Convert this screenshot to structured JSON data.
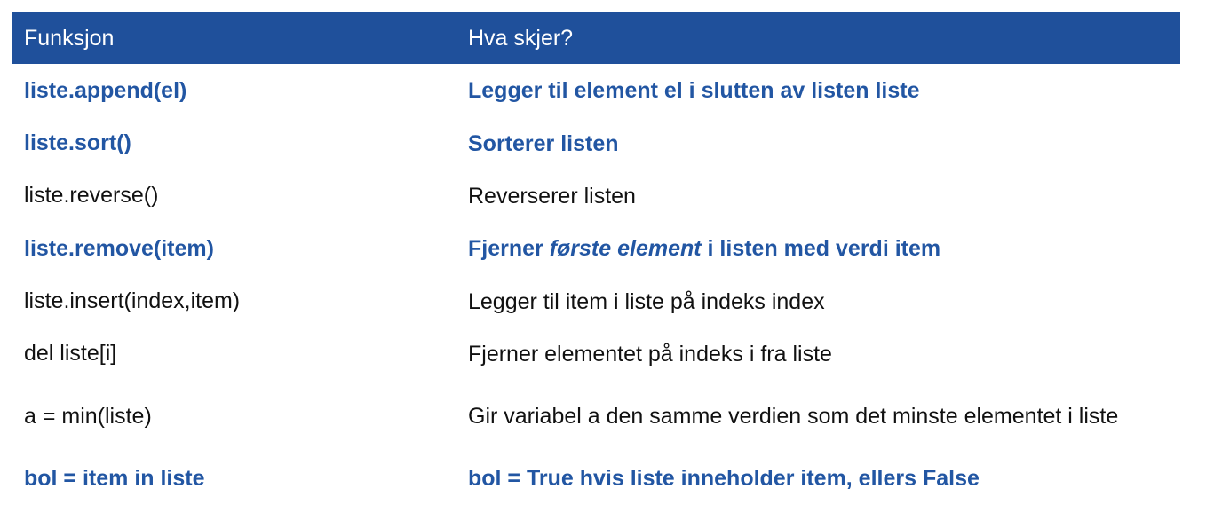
{
  "header": {
    "col1": "Funksjon",
    "col2": "Hva skjer?"
  },
  "rows": [
    {
      "func": "liste.append(el)",
      "desc": "Legger til element el i slutten av listen liste",
      "highlight": true
    },
    {
      "func": "liste.sort()",
      "desc": "Sorterer listen",
      "highlight": true
    },
    {
      "func": "liste.reverse()",
      "desc": "Reverserer listen",
      "highlight": false
    },
    {
      "func": "liste.remove(item)",
      "desc_parts": [
        "Fjerner ",
        "første element",
        " i listen med verdi item"
      ],
      "highlight": true
    },
    {
      "func": "liste.insert(index,item)",
      "desc": "Legger til item i liste på indeks index",
      "highlight": false
    },
    {
      "func": "del liste[i]",
      "desc": "Fjerner elementet på indeks i fra liste",
      "highlight": false
    },
    {
      "func": "a = min(liste)",
      "desc": "Gir variabel a den samme verdien som det minste elementet i liste",
      "highlight": false
    },
    {
      "func": "bol = item in liste",
      "desc": "bol = True hvis liste inneholder item, ellers False",
      "highlight": true
    }
  ],
  "colors": {
    "header_bg": "#1f509b",
    "highlight_text": "#2256a3",
    "normal_text": "#111111"
  }
}
